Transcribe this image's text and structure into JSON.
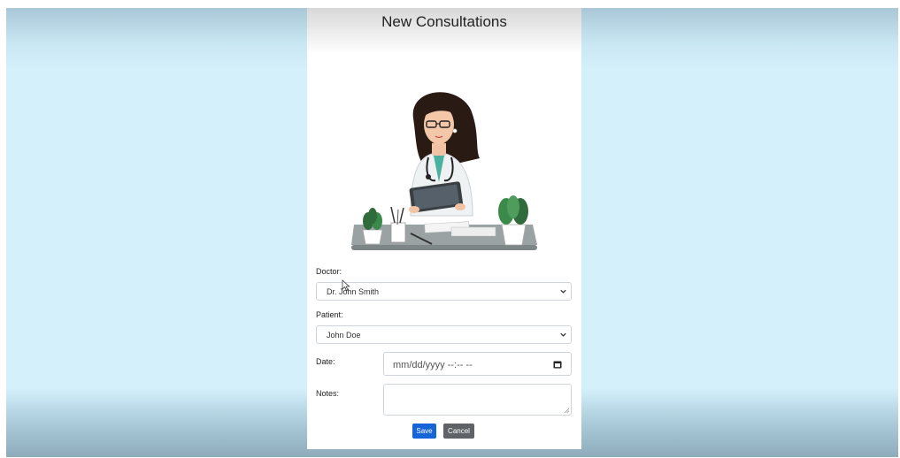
{
  "form": {
    "title": "New Consultations",
    "doctor_label": "Doctor:",
    "doctor_value": "Dr. John Smith",
    "patient_label": "Patient:",
    "patient_value": "John Doe",
    "date_label": "Date:",
    "date_placeholder": "mm/dd/yyyy --:-- --",
    "notes_label": "Notes:",
    "notes_value": "",
    "save_label": "Save",
    "cancel_label": "Cancel"
  },
  "colors": {
    "backdrop": "#d4f0fb",
    "save": "#1565d8",
    "cancel": "#5f6368"
  },
  "icons": {
    "select_chevron": "chevron-down-icon",
    "date_picker": "calendar-icon",
    "textarea_grip": "resize-grip-icon",
    "illustration": "doctor-illustration"
  }
}
